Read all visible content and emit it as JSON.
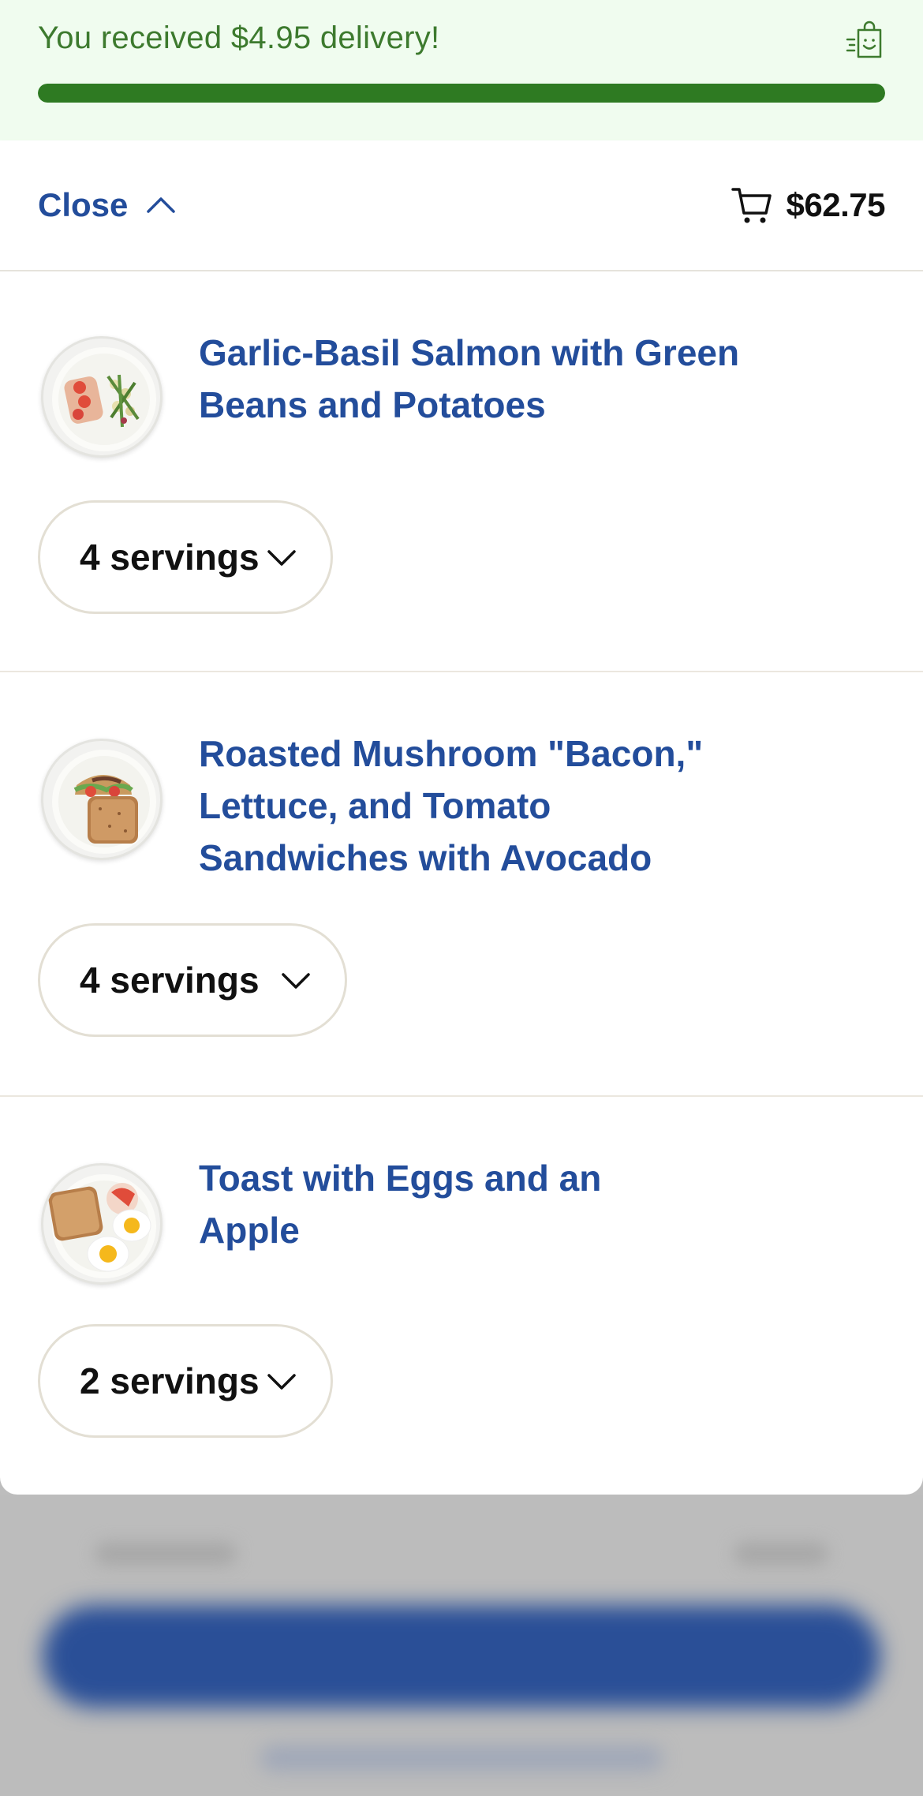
{
  "banner": {
    "message": "You received $4.95 delivery!",
    "progress_percent": 100,
    "icon": "shopping-bag-smile-icon",
    "accent_color": "#2e7a22"
  },
  "header": {
    "close_label": "Close",
    "close_icon": "chevron-up-icon",
    "cart_icon": "cart-icon",
    "cart_total": "$62.75"
  },
  "recipes": [
    {
      "title": "Garlic-Basil Salmon with Green Beans and Potatoes",
      "servings": "4 servings",
      "image": "salmon-plate"
    },
    {
      "title": "Roasted Mushroom \"Bacon,\" Lettuce, and Tomato Sandwiches with Avocado",
      "servings": "4 servings",
      "image": "blt-sandwich-plate"
    },
    {
      "title": "Toast with Eggs and an Apple",
      "servings": "2 servings",
      "image": "toast-eggs-apple-plate"
    }
  ],
  "colors": {
    "link_blue": "#234d9b",
    "banner_bg": "#f0fcef",
    "banner_text": "#3d7a2e"
  }
}
